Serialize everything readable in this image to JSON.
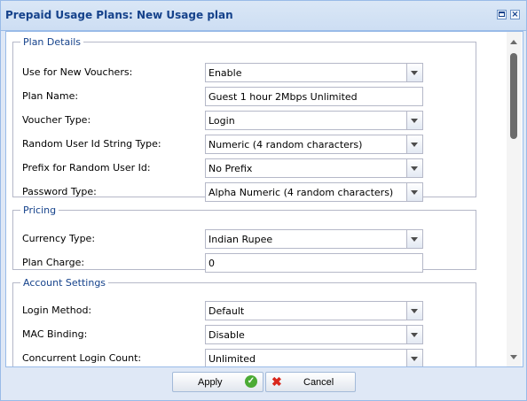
{
  "window": {
    "title": "Prepaid Usage Plans: New Usage plan",
    "close_glyph": "×"
  },
  "plan_details": {
    "legend": "Plan Details",
    "fields": [
      {
        "label": "Use for New Vouchers:",
        "value": "Enable"
      },
      {
        "label": "Plan Name:",
        "value": "Guest 1 hour 2Mbps Unlimited"
      },
      {
        "label": "Voucher Type:",
        "value": "Login"
      },
      {
        "label": "Random User Id String Type:",
        "value": "Numeric (4 random characters)"
      },
      {
        "label": "Prefix for Random User Id:",
        "value": "No Prefix"
      },
      {
        "label": "Password Type:",
        "value": "Alpha Numeric (4 random characters)"
      }
    ]
  },
  "pricing": {
    "legend": "Pricing",
    "fields": [
      {
        "label": "Currency Type:",
        "value": "Indian Rupee"
      },
      {
        "label": "Plan Charge:",
        "value": "0"
      }
    ]
  },
  "account_settings": {
    "legend": "Account Settings",
    "fields": [
      {
        "label": "Login Method:",
        "value": "Default"
      },
      {
        "label": "MAC Binding:",
        "value": "Disable"
      },
      {
        "label": "Concurrent Login Count:",
        "value": "Unlimited"
      }
    ]
  },
  "footer": {
    "apply_label": "Apply",
    "cancel_label": "Cancel",
    "apply_icon": "check-icon",
    "cancel_icon": "close-icon"
  },
  "colors": {
    "title_text": "#15428b",
    "border": "#99bbe8",
    "apply_icon": "#4bab35",
    "cancel_icon": "#d9271c"
  }
}
